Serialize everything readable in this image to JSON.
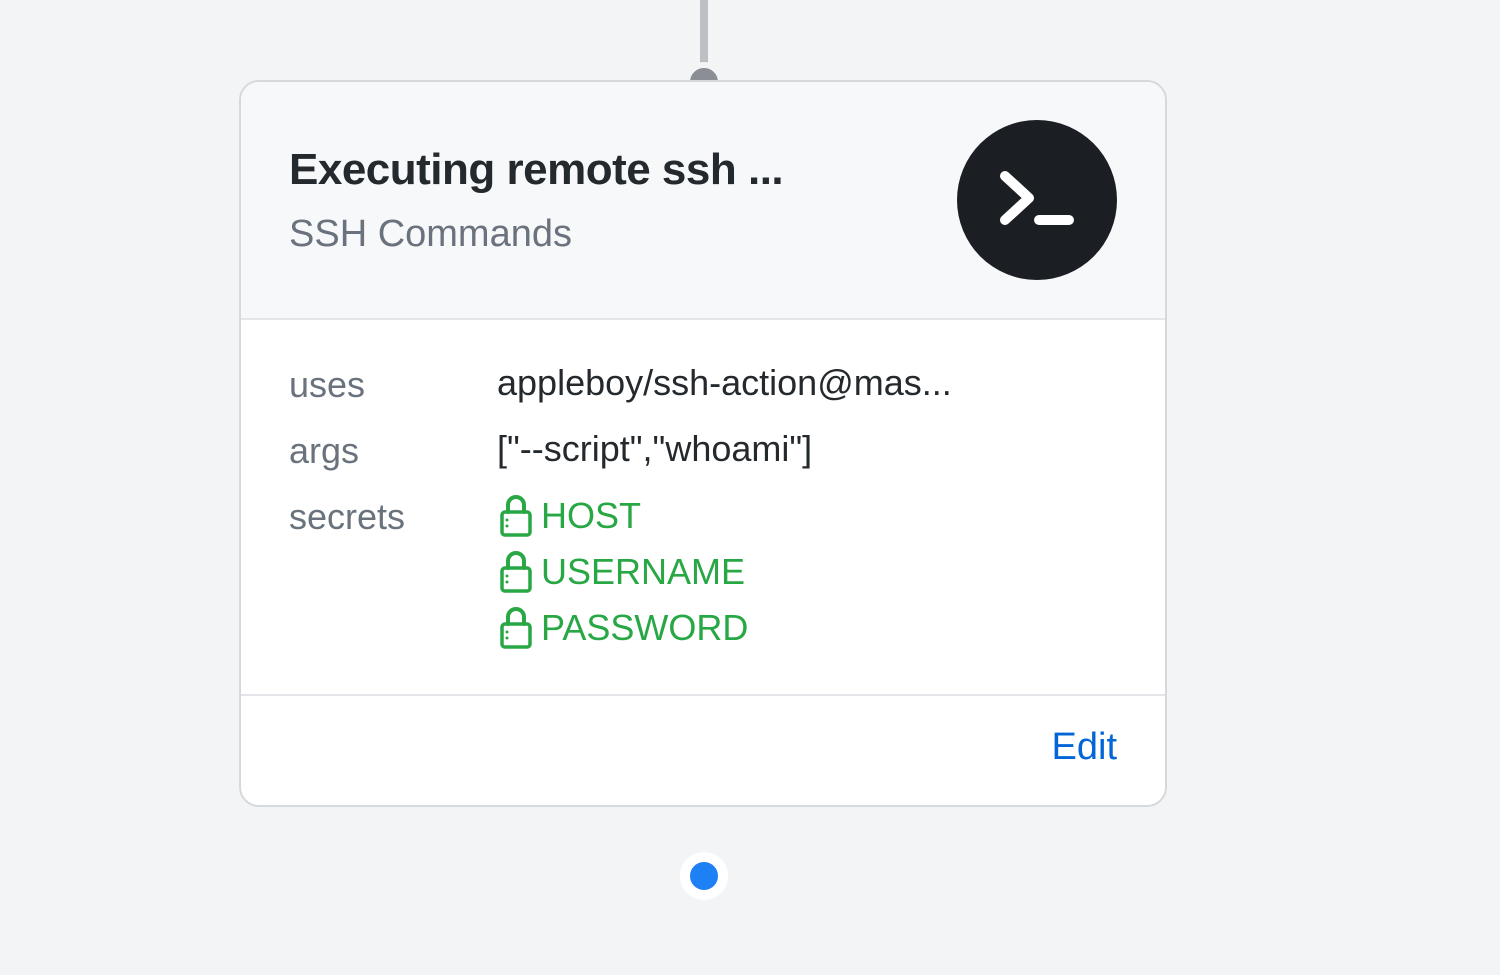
{
  "card": {
    "title": "Executing remote ssh ...",
    "subtitle": "SSH Commands",
    "fields": {
      "uses": {
        "label": "uses",
        "value": "appleboy/ssh-action@mas..."
      },
      "args": {
        "label": "args",
        "value": "[\"--script\",\"whoami\"]"
      },
      "secrets": {
        "label": "secrets",
        "items": [
          "HOST",
          "USERNAME",
          "PASSWORD"
        ]
      }
    },
    "edit_label": "Edit"
  },
  "colors": {
    "secret_green": "#28a745",
    "link_blue": "#0366d6",
    "icon_dark": "#1b1f23"
  }
}
